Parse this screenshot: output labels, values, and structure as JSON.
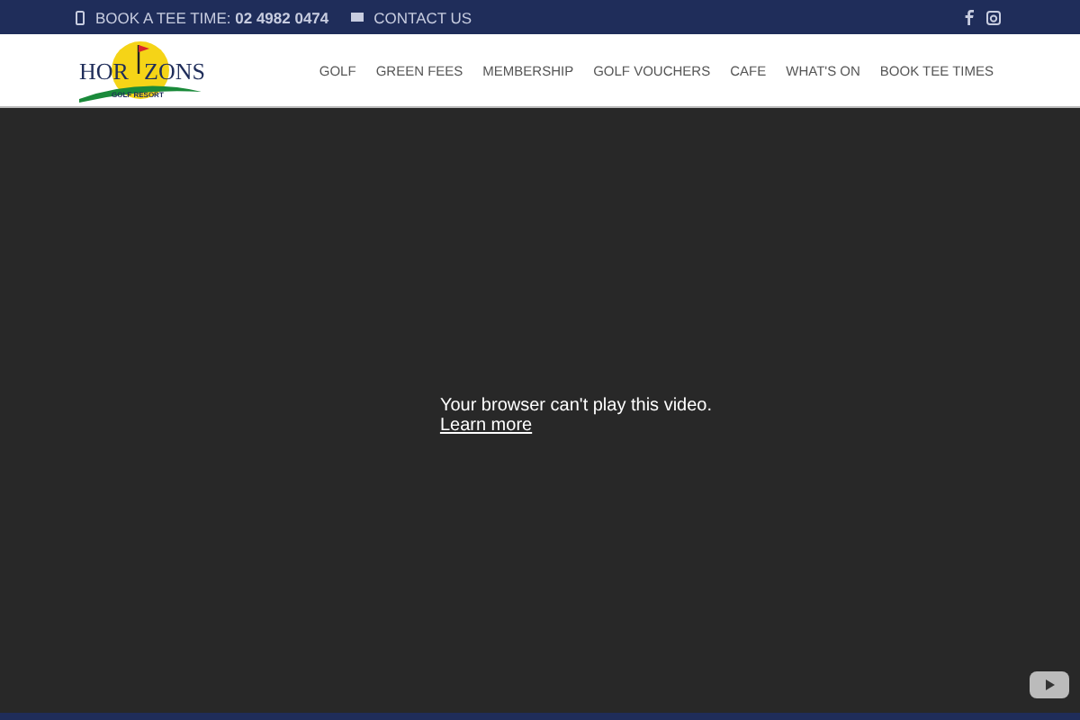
{
  "top_bar": {
    "phone": "BOOK A TEE TIME: **02 4982 0474**",
    "contact": "CONTACT US"
  },
  "logo": {
    "left": "HOR",
    "right": "ZONS",
    "tagline": "GOLF RESORT"
  },
  "nav": [
    {
      "label": "GOLF"
    },
    {
      "label": "GREEN FEES"
    },
    {
      "label": "MEMBERSHIP"
    },
    {
      "label": "GOLF VOUCHERS"
    },
    {
      "label": "CAFE"
    },
    {
      "label": "WHAT'S ON"
    },
    {
      "label": "BOOK TEE TIMES"
    }
  ],
  "video": {
    "message": "Your browser can't play this video.",
    "link": "Learn more"
  }
}
